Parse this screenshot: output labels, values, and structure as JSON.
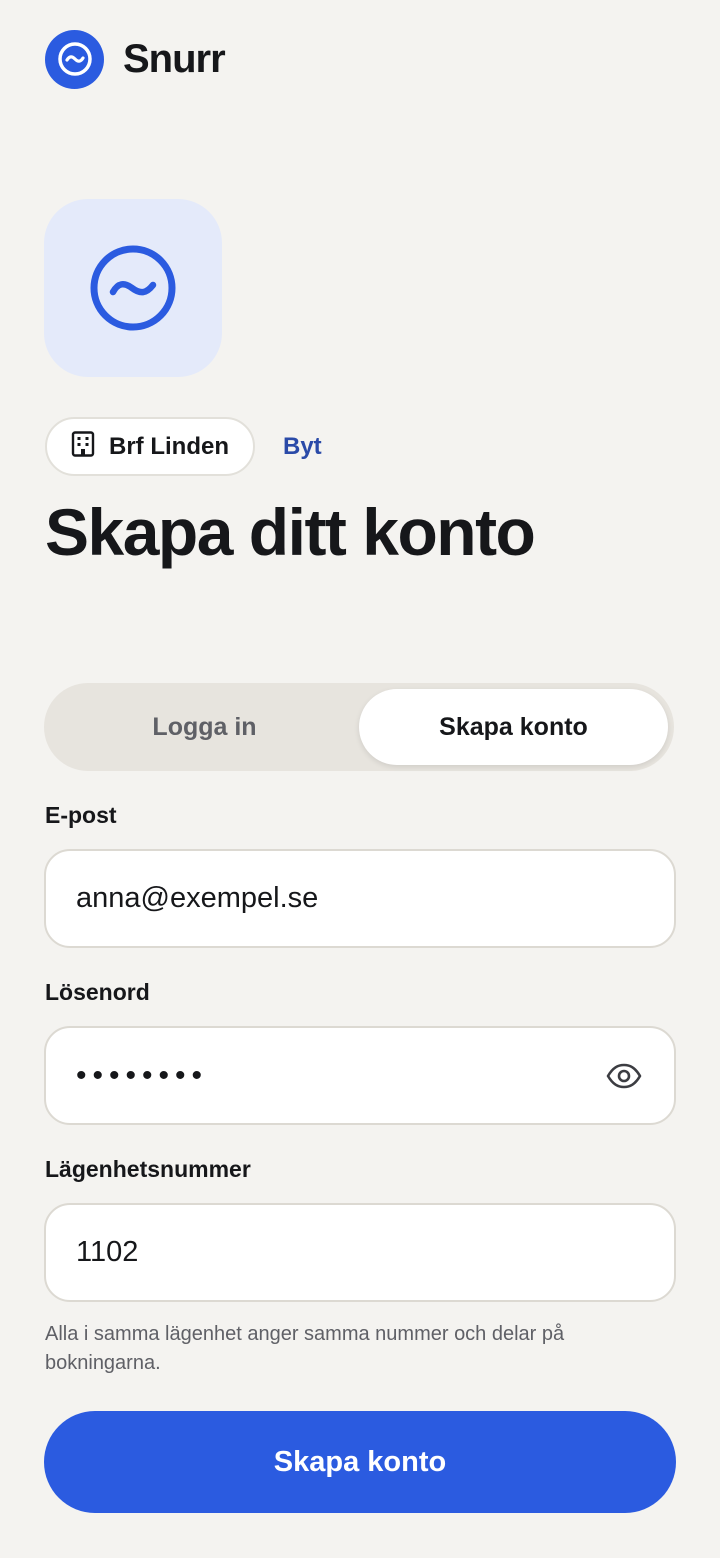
{
  "brand": {
    "name": "Snurr",
    "logo_icon": "wave-circle-icon",
    "accent_color": "#2b5be0"
  },
  "association": {
    "icon": "building-icon",
    "name": "Brf Linden",
    "switch_label": "Byt"
  },
  "title": "Skapa ditt konto",
  "tabs": [
    {
      "label": "Logga in",
      "active": false
    },
    {
      "label": "Skapa konto",
      "active": true
    }
  ],
  "form": {
    "email": {
      "label": "E-post",
      "value": "anna@exempel.se"
    },
    "password": {
      "label": "Lösenord",
      "value": "••••••••",
      "toggle_icon": "eye-icon"
    },
    "apartment": {
      "label": "Lägenhetsnummer",
      "value": "1102",
      "help": "Alla i samma lägenhet anger samma nummer och delar på bokningarna."
    },
    "submit_label": "Skapa konto"
  }
}
